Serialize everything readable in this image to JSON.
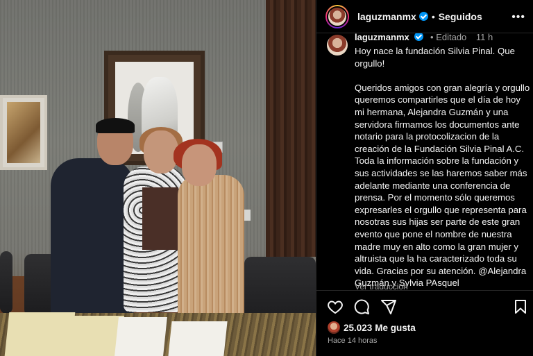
{
  "header": {
    "username": "laguzmanmx",
    "separator": "•",
    "follow_state": "Seguidos",
    "more_icon": "more-horizontal-icon"
  },
  "caption": {
    "username": "laguzmanmx",
    "edited_label": "Editado",
    "separator": "•",
    "time": "11 h",
    "text": "Hoy nace la fundación Silvia Pinal. Que orgullo!\n\nQueridos amigos con gran alegría y orgullo queremos compartirles que el día de hoy mi hermana, Alejandra Guzmán y una servidora firmamos los documentos ante notario para la protocolizacion de la creación de la Fundación Silvia Pinal A.C. Toda la información sobre la fundación y sus actividades se las haremos saber más adelante mediante una conferencia de prensa. Por el momento sólo queremos expresarles el orgullo que representa para nosotras sus hijas ser parte de este gran evento que pone el nombre de nuestra madre muy en alto como la gran mujer y altruista que la ha caracterizado toda su vida. Gracias por su atención. @Alejandra Guzmán y Sylvia PAsquel",
    "see_translation": "Ver traducción"
  },
  "actions": {
    "like_icon": "heart-icon",
    "comment_icon": "comment-icon",
    "share_icon": "share-icon",
    "save_icon": "bookmark-icon"
  },
  "likes": {
    "count": "25.023",
    "label": "Me gusta"
  },
  "timestamp": "Hace 14 horas",
  "colors": {
    "background": "#000000",
    "text": "#f5f5f5",
    "secondary_text": "#a8a8a8",
    "verified_blue": "#0095f6",
    "divider": "#262626"
  }
}
